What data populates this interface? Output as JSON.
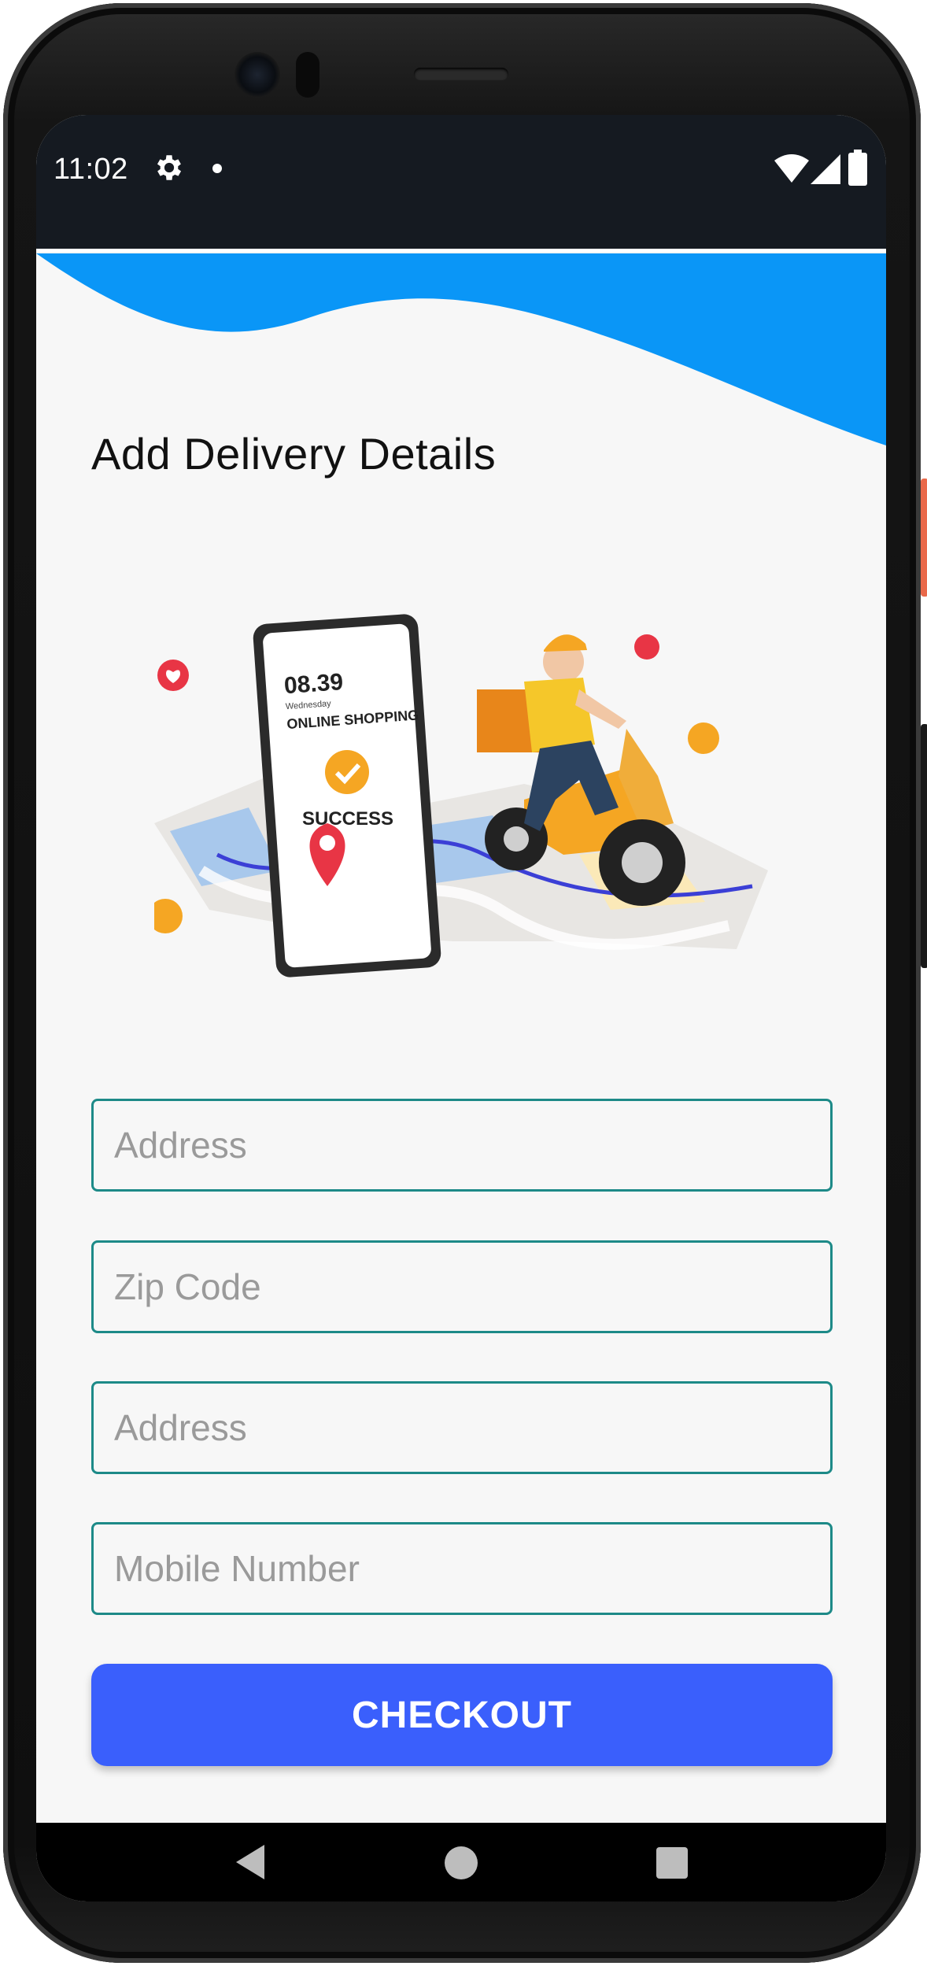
{
  "status_bar": {
    "time": "11:02",
    "icons": [
      "gear-icon",
      "notification-dot",
      "wifi-icon",
      "signal-icon",
      "battery-icon"
    ]
  },
  "page": {
    "title": "Add Delivery Details"
  },
  "illustration": {
    "phone_time": "08.39",
    "phone_day": "Wednesday",
    "phone_heading": "ONLINE SHOPPING",
    "phone_status": "SUCCESS"
  },
  "form": {
    "fields": [
      {
        "placeholder": "Address",
        "value": ""
      },
      {
        "placeholder": "Zip Code",
        "value": ""
      },
      {
        "placeholder": "Address",
        "value": ""
      },
      {
        "placeholder": "Mobile Number",
        "value": ""
      }
    ],
    "checkout_label": "CHECKOUT"
  },
  "navigation": {
    "buttons": [
      "back-icon",
      "home-icon",
      "recents-icon"
    ]
  },
  "colors": {
    "accent_wave": "#0a96f7",
    "button": "#3a5ffc",
    "field_border": "#1d8a88",
    "status_bar": "#151a21"
  }
}
